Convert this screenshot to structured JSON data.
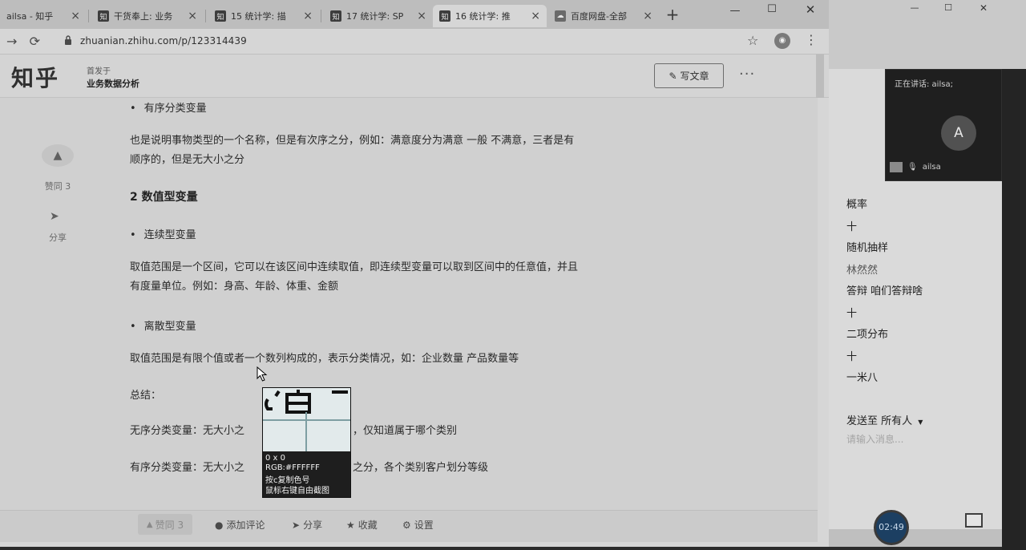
{
  "browser": {
    "tabs": [
      {
        "title": "ailsa - 知乎",
        "favicon": ""
      },
      {
        "title": "干货奉上: 业务",
        "favicon": "知"
      },
      {
        "title": "15 统计学: 描",
        "favicon": "知"
      },
      {
        "title": "17 统计学: SP",
        "favicon": "知"
      },
      {
        "title": "16 统计学: 推",
        "favicon": "知"
      },
      {
        "title": "百度网盘-全部",
        "favicon": "☁"
      }
    ],
    "url": "zhuanian.zhihu.com/p/123314439",
    "new_tab": "+"
  },
  "zhihu": {
    "logo": "知乎",
    "column_subtitle": "首发于",
    "column_name": "业务数据分析",
    "write_button": "写文章",
    "more": "···"
  },
  "sidebar": {
    "vote_label": "赞同 3",
    "share_label": "分享"
  },
  "article": {
    "bullet_ordinal": "有序分类变量",
    "p_ordinal": "也是说明事物类型的一个名称，但是有次序之分，例如：满意度分为满意 一般 不满意，三者是有",
    "p_ordinal_2": "顺序的，但是无大小之分",
    "h_numeric": "2 数值型变量",
    "bullet_continuous": "连续型变量",
    "p_continuous": "取值范围是一个区间，它可以在该区间中连续取值，即连续型变量可以取到区间中的任意值，并且",
    "p_continuous_2": "有度量单位。例如：身高、年龄、体重、金额",
    "bullet_discrete": "离散型变量",
    "p_discrete": "取值范围是有限个值或者一个数列构成的，表示分类情况，如：企业数量 产品数量等",
    "summary": "总结：",
    "sum_1_a": "无序分类变量：无大小之",
    "sum_1_b": "，仅知道属于哪个类别",
    "sum_2_a": "有序分类变量：无大小之",
    "sum_2_b": "之分，各个类别客户划分等级"
  },
  "actions": {
    "vote": "赞同 3",
    "comment": "添加评论",
    "share": "分享",
    "collect": "收藏",
    "settings": "设置"
  },
  "picker": {
    "size": "0 x 0",
    "rgb": "RGB:#FFFFFF",
    "copy_hint": "按c复制色号",
    "capture_hint": "鼠标右键自由截图"
  },
  "right_panel": {
    "speaking": "正在讲话: ailsa;",
    "avatar_letter": "A",
    "video_user": "ailsa",
    "chat": [
      {
        "text": "概率",
        "dim": false
      },
      {
        "text": "十",
        "dim": false
      },
      {
        "text": "随机抽样",
        "dim": false
      },
      {
        "text": "林然然",
        "dim": true
      },
      {
        "text": "答辩 咱们答辩啥",
        "dim": false
      },
      {
        "text": "十",
        "dim": false
      },
      {
        "text": "二项分布",
        "dim": false
      },
      {
        "text": "十",
        "dim": false
      },
      {
        "text": "一米八",
        "dim": false
      }
    ],
    "send_to": "发送至 所有人",
    "input_placeholder": "请输入消息...",
    "timer": "02:49"
  }
}
